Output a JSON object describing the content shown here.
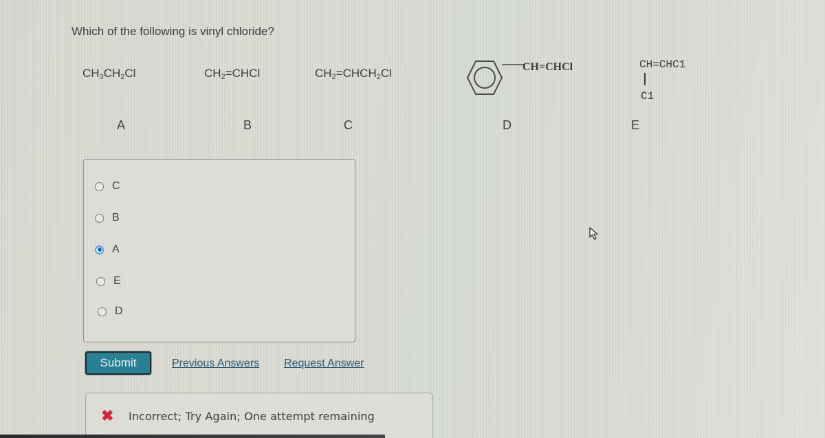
{
  "question": {
    "text": "Which of the following is vinyl chloride?"
  },
  "options": {
    "a": {
      "letter": "A",
      "formula_parts": [
        "CH",
        "3",
        "CH",
        "2",
        "Cl"
      ]
    },
    "b": {
      "letter": "B",
      "formula_parts": [
        "CH",
        "2",
        "=CHCl"
      ]
    },
    "c": {
      "letter": "C",
      "formula_parts": [
        "CH",
        "2",
        "=CHCH",
        "2",
        "Cl"
      ]
    },
    "d": {
      "letter": "D",
      "substituent": "CH=CHCl",
      "ring_icon": "benzene-ring-icon"
    },
    "e": {
      "letter": "E",
      "top": "CH=CHC1",
      "bottom": "C1"
    }
  },
  "choices": [
    {
      "label": "C",
      "selected": false
    },
    {
      "label": "B",
      "selected": false
    },
    {
      "label": "A",
      "selected": true
    },
    {
      "label": "E",
      "selected": false
    },
    {
      "label": "D",
      "selected": false
    }
  ],
  "actions": {
    "submit_label": "Submit",
    "previous_answers_label": "Previous Answers",
    "request_answer_label": "Request Answer"
  },
  "feedback": {
    "icon": "x-icon",
    "icon_glyph": "✖",
    "text": "Incorrect; Try Again; One attempt remaining",
    "color": "#d0283a"
  },
  "colors": {
    "submit_bg": "#2a7f93",
    "link": "#2f5570",
    "radio_selected": "#1565c0"
  }
}
